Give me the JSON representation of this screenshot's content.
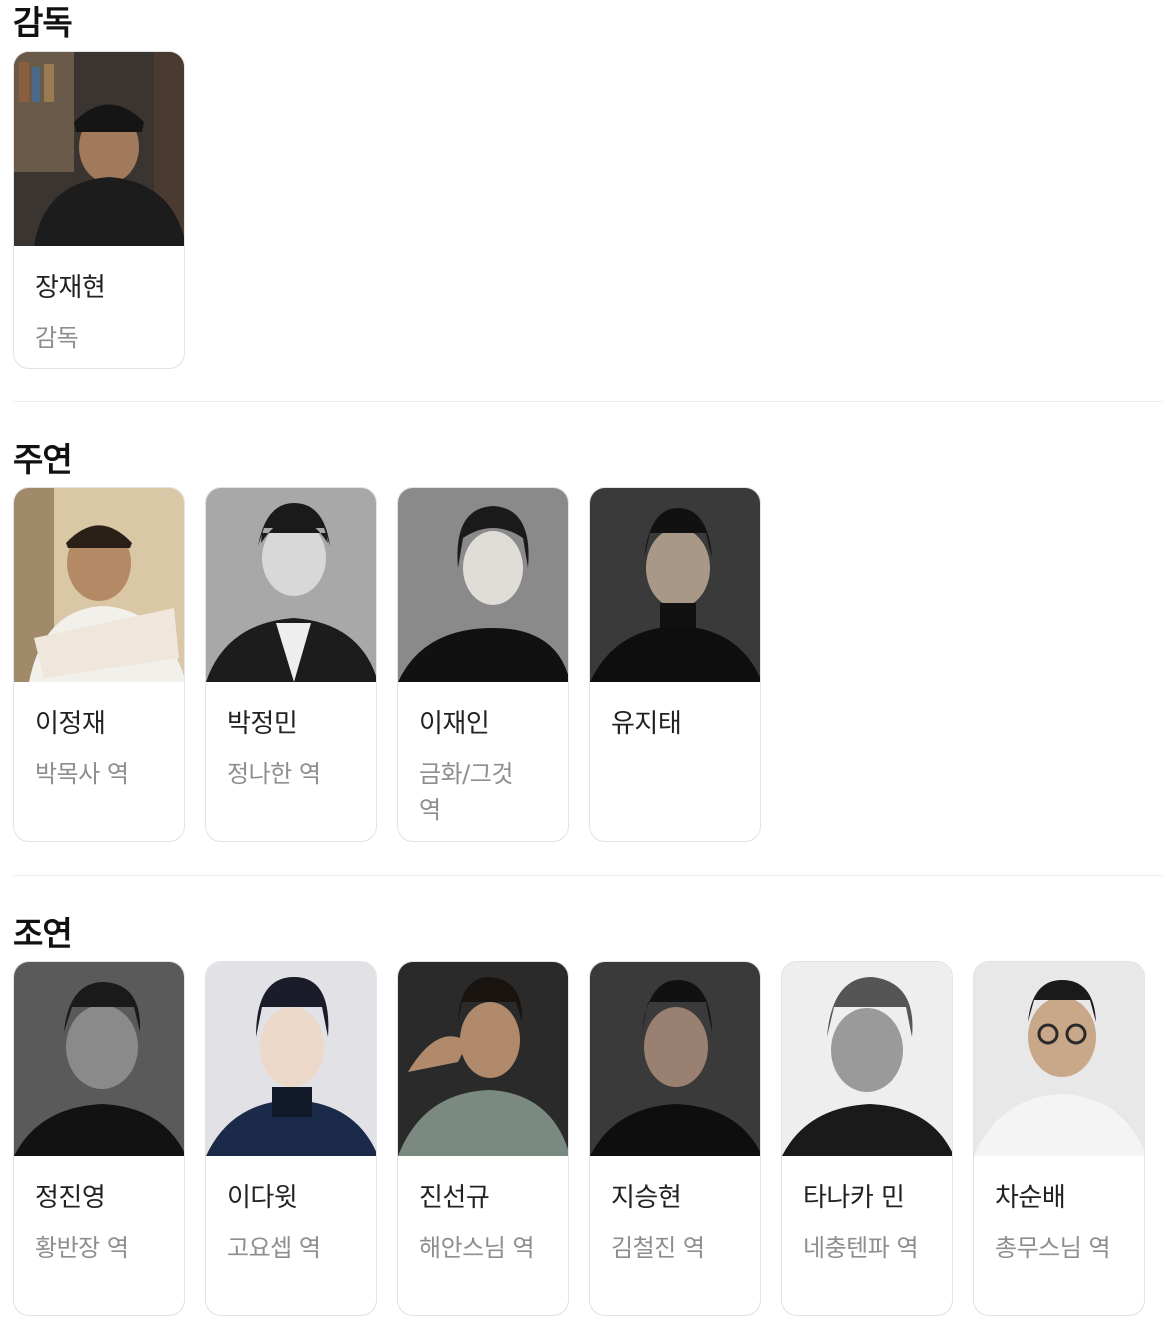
{
  "sections": [
    {
      "title": "감독",
      "people": [
        {
          "name": "장재현",
          "role": "감독",
          "photo_tone": "#2a2a2a"
        }
      ]
    },
    {
      "title": "주연",
      "people": [
        {
          "name": "이정재",
          "role": "박목사 역",
          "photo_tone": "#c9b89a"
        },
        {
          "name": "박정민",
          "role": "정나한 역",
          "photo_tone": "#9a9a9a"
        },
        {
          "name": "이재인",
          "role": "금화/그것 역",
          "photo_tone": "#6e6e6e"
        },
        {
          "name": "유지태",
          "role": "",
          "photo_tone": "#3a3a3a"
        }
      ]
    },
    {
      "title": "조연",
      "people": [
        {
          "name": "정진영",
          "role": "황반장 역",
          "photo_tone": "#4a4a4a"
        },
        {
          "name": "이다윗",
          "role": "고요셉 역",
          "photo_tone": "#d8d8dc"
        },
        {
          "name": "진선규",
          "role": "해안스님 역",
          "photo_tone": "#2c2c2c"
        },
        {
          "name": "지승현",
          "role": "김철진 역",
          "photo_tone": "#3c3c3c"
        },
        {
          "name": "타나카 민",
          "role": "네충텐파 역",
          "photo_tone": "#e6e6e6"
        },
        {
          "name": "차순배",
          "role": "총무스님 역",
          "photo_tone": "#e9e9e9"
        }
      ]
    }
  ]
}
